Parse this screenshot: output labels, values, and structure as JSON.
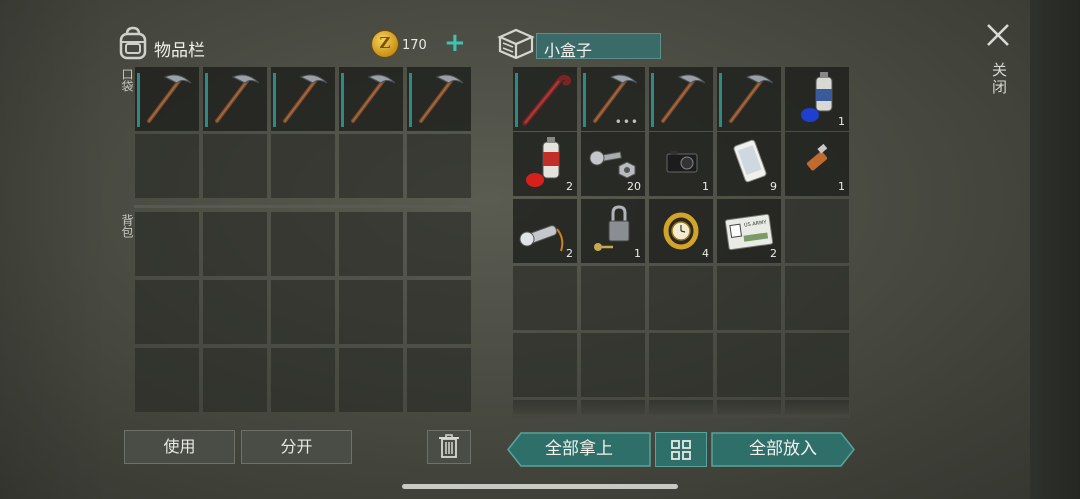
{
  "inventory": {
    "title": "物品栏",
    "icon": "backpack-icon",
    "coins": "170",
    "coin_symbol": "Z",
    "add_coins": "+",
    "pocket_label": "口袋",
    "backpack_label": "背包",
    "pocket_items": [
      "pickaxe-icon",
      "pickaxe-icon",
      "pickaxe-icon",
      "pickaxe-icon",
      "pickaxe-icon"
    ]
  },
  "box": {
    "icon": "box-icon",
    "name": "小盒子",
    "items": [
      {
        "icon": "crowbar-icon",
        "count": ""
      },
      {
        "icon": "pickaxe-icon",
        "count": "",
        "more": "•••"
      },
      {
        "icon": "pickaxe-icon",
        "count": ""
      },
      {
        "icon": "pickaxe-icon",
        "count": ""
      },
      {
        "icon": "spray-can-blue-icon",
        "count": "1"
      },
      {
        "icon": "spray-can-red-icon",
        "count": "2"
      },
      {
        "icon": "bolt-nut-icon",
        "count": "20"
      },
      {
        "icon": "camera-icon",
        "count": "1"
      },
      {
        "icon": "smartphone-icon",
        "count": "9"
      },
      {
        "icon": "usb-drive-icon",
        "count": "1"
      },
      {
        "icon": "flashlight-icon",
        "count": "2"
      },
      {
        "icon": "padlock-key-icon",
        "count": "1"
      },
      {
        "icon": "wristwatch-icon",
        "count": "4"
      },
      {
        "icon": "id-card-icon",
        "count": "2",
        "card_text": "US ARMY"
      }
    ]
  },
  "close": {
    "icon": "close-icon",
    "label": "关闭"
  },
  "buttons": {
    "use": "使用",
    "split": "分开",
    "trash_icon": "trash-icon",
    "take_all": "全部拿上",
    "sort_icon": "grid-icon",
    "put_all": "全部放入"
  },
  "colors": {
    "accent": "#3a6b68",
    "teal": "#2f8a86",
    "coin": "#e0a82a"
  }
}
